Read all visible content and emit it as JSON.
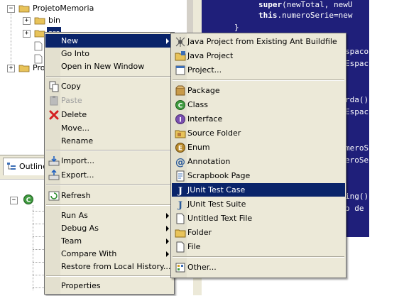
{
  "tree": {
    "root": "ProjetoMemoria",
    "child1": "bin",
    "child2_partial": "src",
    "root2_partial": "Proj"
  },
  "outline": {
    "tab_label": "Outline"
  },
  "editor": {
    "lines": [
      {
        "kw": "super",
        "rest": "(newTotal, newU"
      },
      {
        "kw": "this",
        "rest": ".numeroSerie=new"
      },
      {
        "kw": "",
        "rest": "}"
      },
      {
        "kw": "",
        "rest": "spacoL"
      },
      {
        "kw": "",
        "rest": "Espac"
      },
      {
        "kw": "",
        "rest": "rda()"
      },
      {
        "kw": "",
        "rest": "Espac"
      },
      {
        "kw": "",
        "rest": "meroS"
      },
      {
        "kw": "",
        "rest": "eroSe"
      },
      {
        "kw": "",
        "rest": "ing()"
      },
      {
        "kw": "",
        "rest": "o de"
      }
    ]
  },
  "context_menu": {
    "items": [
      {
        "label": "New",
        "submenu": true,
        "selected": true
      },
      {
        "label": "Go Into"
      },
      {
        "label": "Open in New Window"
      },
      {
        "label": "Copy"
      },
      {
        "label": "Paste",
        "disabled": true
      },
      {
        "label": "Delete"
      },
      {
        "label": "Move..."
      },
      {
        "label": "Rename"
      },
      {
        "label": "Import..."
      },
      {
        "label": "Export..."
      },
      {
        "label": "Refresh"
      },
      {
        "label": "Run As",
        "submenu": true
      },
      {
        "label": "Debug As",
        "submenu": true
      },
      {
        "label": "Team",
        "submenu": true
      },
      {
        "label": "Compare With",
        "submenu": true
      },
      {
        "label": "Restore from Local History..."
      },
      {
        "label": "Properties"
      }
    ]
  },
  "new_submenu": {
    "items": [
      {
        "label": "Java Project from Existing Ant Buildfile",
        "icon": "ant-project-icon"
      },
      {
        "label": "Java Project",
        "icon": "java-project-icon"
      },
      {
        "label": "Project...",
        "icon": "project-icon"
      },
      {
        "label": "Package",
        "icon": "package-icon"
      },
      {
        "label": "Class",
        "icon": "class-icon"
      },
      {
        "label": "Interface",
        "icon": "interface-icon"
      },
      {
        "label": "Source Folder",
        "icon": "source-folder-icon"
      },
      {
        "label": "Enum",
        "icon": "enum-icon"
      },
      {
        "label": "Annotation",
        "icon": "annotation-icon"
      },
      {
        "label": "Scrapbook Page",
        "icon": "scrapbook-icon"
      },
      {
        "label": "JUnit Test Case",
        "icon": "junit-test-case-icon",
        "selected": true
      },
      {
        "label": "JUnit Test Suite",
        "icon": "junit-test-suite-icon"
      },
      {
        "label": "Untitled Text File",
        "icon": "text-file-icon"
      },
      {
        "label": "Folder",
        "icon": "folder-icon"
      },
      {
        "label": "File",
        "icon": "file-icon"
      },
      {
        "label": "Other...",
        "icon": "other-icon"
      }
    ]
  },
  "colors": {
    "menu_bg": "#ece9d8",
    "selection": "#0a246a",
    "editor_bg": "#1f1f7a"
  }
}
